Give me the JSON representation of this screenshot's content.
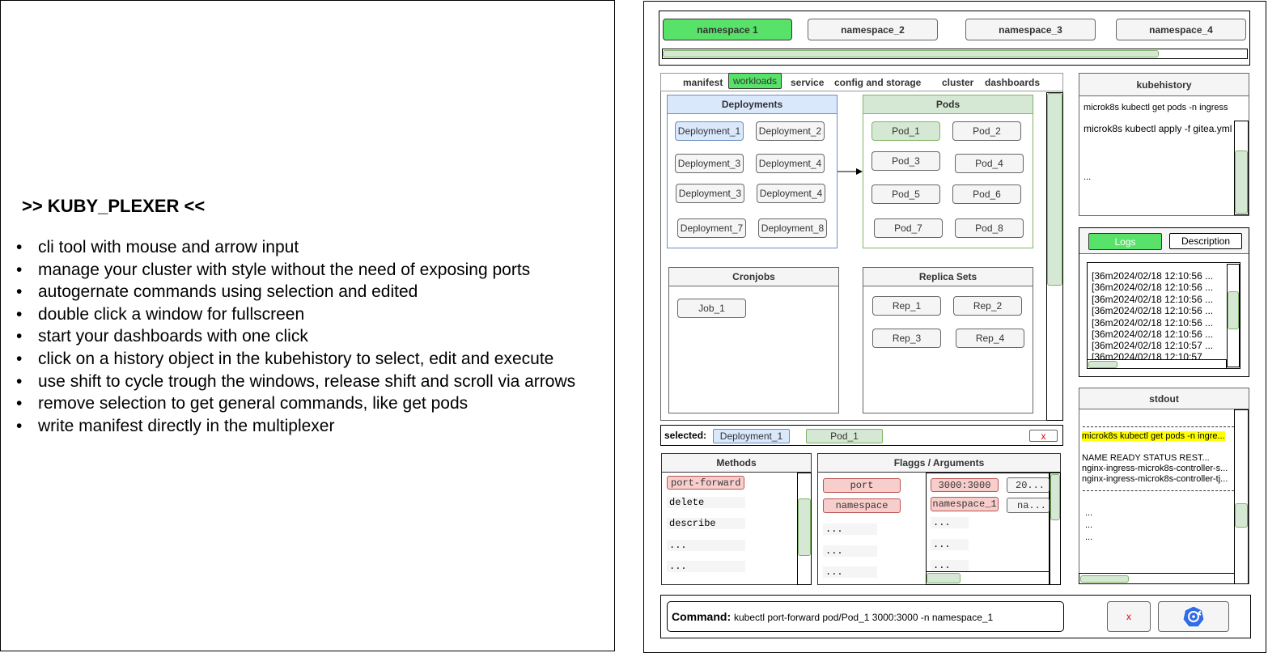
{
  "intro": {
    "title": ">> KUBY_PLEXER <<",
    "bullets": [
      "cli tool with mouse and arrow input",
      "manage your cluster with style without the need of exposing ports",
      "autogernate commands using selection and  edited",
      "double click a window for fullscreen",
      "start your dashboards with one click",
      "click on a history object in the kubehistory to select, edit and execute",
      "use shift to cycle trough the windows, release shift and scroll via arrows",
      "remove selection to get general commands, like get pods",
      "write manifest directly in the multiplexer"
    ]
  },
  "namespaces": [
    "namespace 1",
    "namespace_2",
    "namespace_3",
    "namespace_4"
  ],
  "tabs": {
    "manifest": "manifest",
    "workloads": "workloads",
    "service": "service",
    "config": "config and storage",
    "cluster": "cluster",
    "dashboards": "dashboards"
  },
  "deployments": {
    "title": "Deployments",
    "items": [
      "Deployment_1",
      "Deployment_2",
      "Deployment_3",
      "Deployment_4",
      "Deployment_3",
      "Deployment_4",
      "Deployment_7",
      "Deployment_8"
    ]
  },
  "pods": {
    "title": "Pods",
    "items": [
      "Pod_1",
      "Pod_2",
      "Pod_3",
      "Pod_4",
      "Pod_5",
      "Pod_6",
      "Pod_7",
      "Pod_8"
    ]
  },
  "cronjobs": {
    "title": "Cronjobs",
    "items": [
      "Job_1"
    ]
  },
  "replicasets": {
    "title": "Replica Sets",
    "items": [
      "Rep_1",
      "Rep_2",
      "Rep_3",
      "Rep_4"
    ]
  },
  "selected": {
    "label": "selected:",
    "deployment": "Deployment_1",
    "pod": "Pod_1",
    "clear": "x"
  },
  "methods": {
    "title": "Methods",
    "items": [
      "port-forward",
      "delete",
      "describe",
      "...",
      "..."
    ]
  },
  "flags": {
    "title": "Flaggs / Arguments",
    "names": [
      "port",
      "namespace",
      "...",
      "...",
      "..."
    ],
    "values": [
      "3000:3000",
      "namespace_1",
      "...",
      "...",
      "..."
    ],
    "extra": [
      "20...",
      "na..."
    ]
  },
  "command": {
    "label": "Command:",
    "text": "kubectl port-forward pod/Pod_1  3000:3000 -n namespace_1",
    "clear": "x"
  },
  "kubehistory": {
    "title": "kubehistory",
    "items": [
      "microk8s kubectl get pods -n ingress",
      "microk8s kubectl apply -f gitea.yml",
      "..."
    ]
  },
  "logs": {
    "tab_logs": "Logs",
    "tab_description": "Description",
    "lines": [
      "[36m2024/02/18 12:10:56 ...",
      "[36m2024/02/18 12:10:56 ...",
      "[36m2024/02/18 12:10:56 ...",
      "[36m2024/02/18 12:10:56 ...",
      "[36m2024/02/18 12:10:56 ...",
      "[36m2024/02/18 12:10:56 ...",
      "[36m2024/02/18 12:10:57 ...",
      "[36m2024/02/18 12:10:57"
    ]
  },
  "stdout": {
    "title": "stdout",
    "command": "microk8s kubectl get pods -n ingre...",
    "header": "NAME  READY  STATUS   REST...",
    "rows": [
      "nginx-ingress-microk8s-controller-s...",
      "nginx-ingress-microk8s-controller-tj..."
    ],
    "dots": [
      "...",
      "...",
      "..."
    ]
  },
  "colors": {
    "active_green": "#58e26a",
    "selected_blue": "#dae8fc",
    "pod_green": "#d5e8d4",
    "flag_red": "#f8cecc",
    "highlight_yellow": "#ffff00",
    "k8s_blue": "#326ce5"
  }
}
